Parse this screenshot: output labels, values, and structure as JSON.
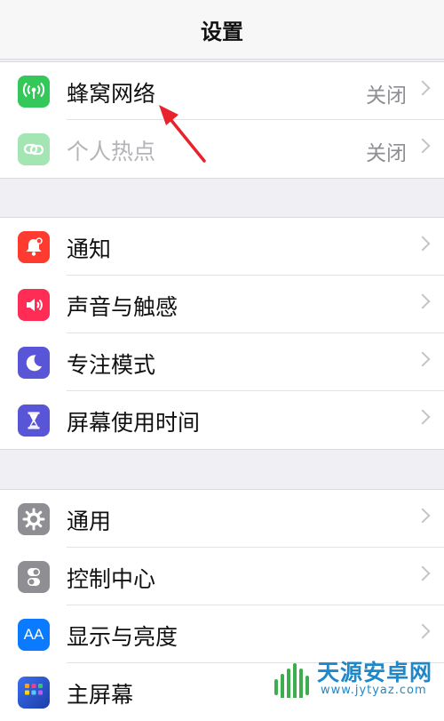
{
  "nav": {
    "title": "设置"
  },
  "group1": {
    "items": [
      {
        "label": "蜂窝网络",
        "value": "关闭",
        "icon": "cellular-antenna-icon",
        "color": "#34c759"
      },
      {
        "label": "个人热点",
        "value": "关闭",
        "icon": "hotspot-link-icon",
        "color": "#34c759",
        "disabled": true
      }
    ]
  },
  "group2": {
    "items": [
      {
        "label": "通知",
        "icon": "bell-icon",
        "color": "#ff3b30"
      },
      {
        "label": "声音与触感",
        "icon": "speaker-icon",
        "color": "#ff2d55"
      },
      {
        "label": "专注模式",
        "icon": "moon-icon",
        "color": "#5856d6"
      },
      {
        "label": "屏幕使用时间",
        "icon": "hourglass-icon",
        "color": "#5856d6"
      }
    ]
  },
  "group3": {
    "items": [
      {
        "label": "通用",
        "icon": "gear-icon",
        "color": "#8e8e93"
      },
      {
        "label": "控制中心",
        "icon": "toggle-switches-icon",
        "color": "#8e8e93"
      },
      {
        "label": "显示与亮度",
        "icon": "text-size-icon",
        "color": "#0a7aff",
        "glyph": "AA"
      },
      {
        "label": "主屏幕",
        "icon": "home-grid-icon",
        "color": "#2c5bd8"
      }
    ]
  },
  "annotation": {
    "arrow_color": "#e8232b"
  },
  "watermark": {
    "title": "天源安卓网",
    "url": "www.jytyaz.com"
  }
}
